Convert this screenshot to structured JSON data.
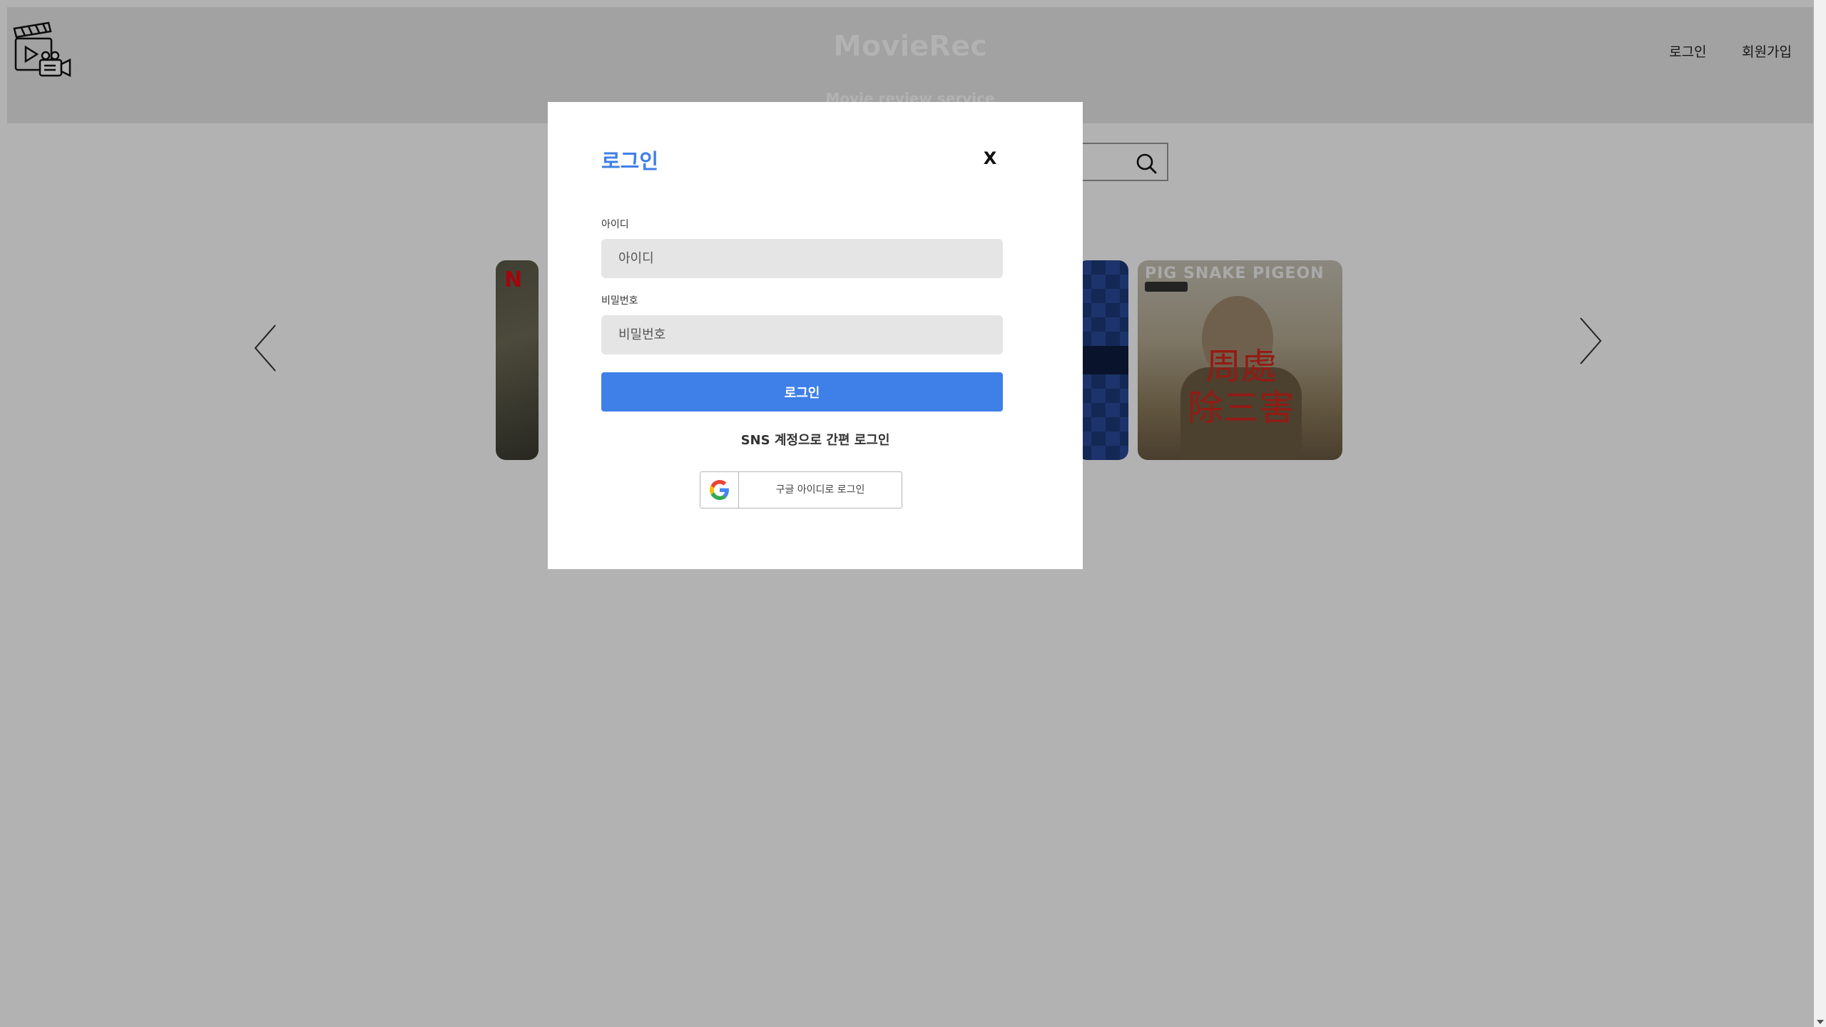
{
  "header": {
    "brand": "MovieRec",
    "tagline": "Movie review service",
    "nav": {
      "login": "로그인",
      "signup": "회원가입"
    }
  },
  "carousel": {
    "poster_4_top_text": "PIG  SNAKE  PIGEON",
    "poster_4_calligraphy": "周處\n除三害",
    "poster_1_logo": "N"
  },
  "modal": {
    "title": "로그인",
    "close": "X",
    "id_label": "아이디",
    "id_placeholder": "아이디",
    "pw_label": "비밀번호",
    "pw_placeholder": "비밀번호",
    "submit": "로그인",
    "sns_caption": "SNS 계정으로 간편 로그인",
    "google_button": "구글 아이디로 로그인"
  },
  "colors": {
    "accent": "#3f7fe8",
    "overlay": "rgba(0,0,0,0.30)",
    "input_bg": "#e5e5e5"
  },
  "icons": {
    "logo": "clapperboard-camera-icon",
    "search": "search-icon",
    "prev": "chevron-left-icon",
    "next": "chevron-right-icon",
    "google": "google-g-icon"
  }
}
